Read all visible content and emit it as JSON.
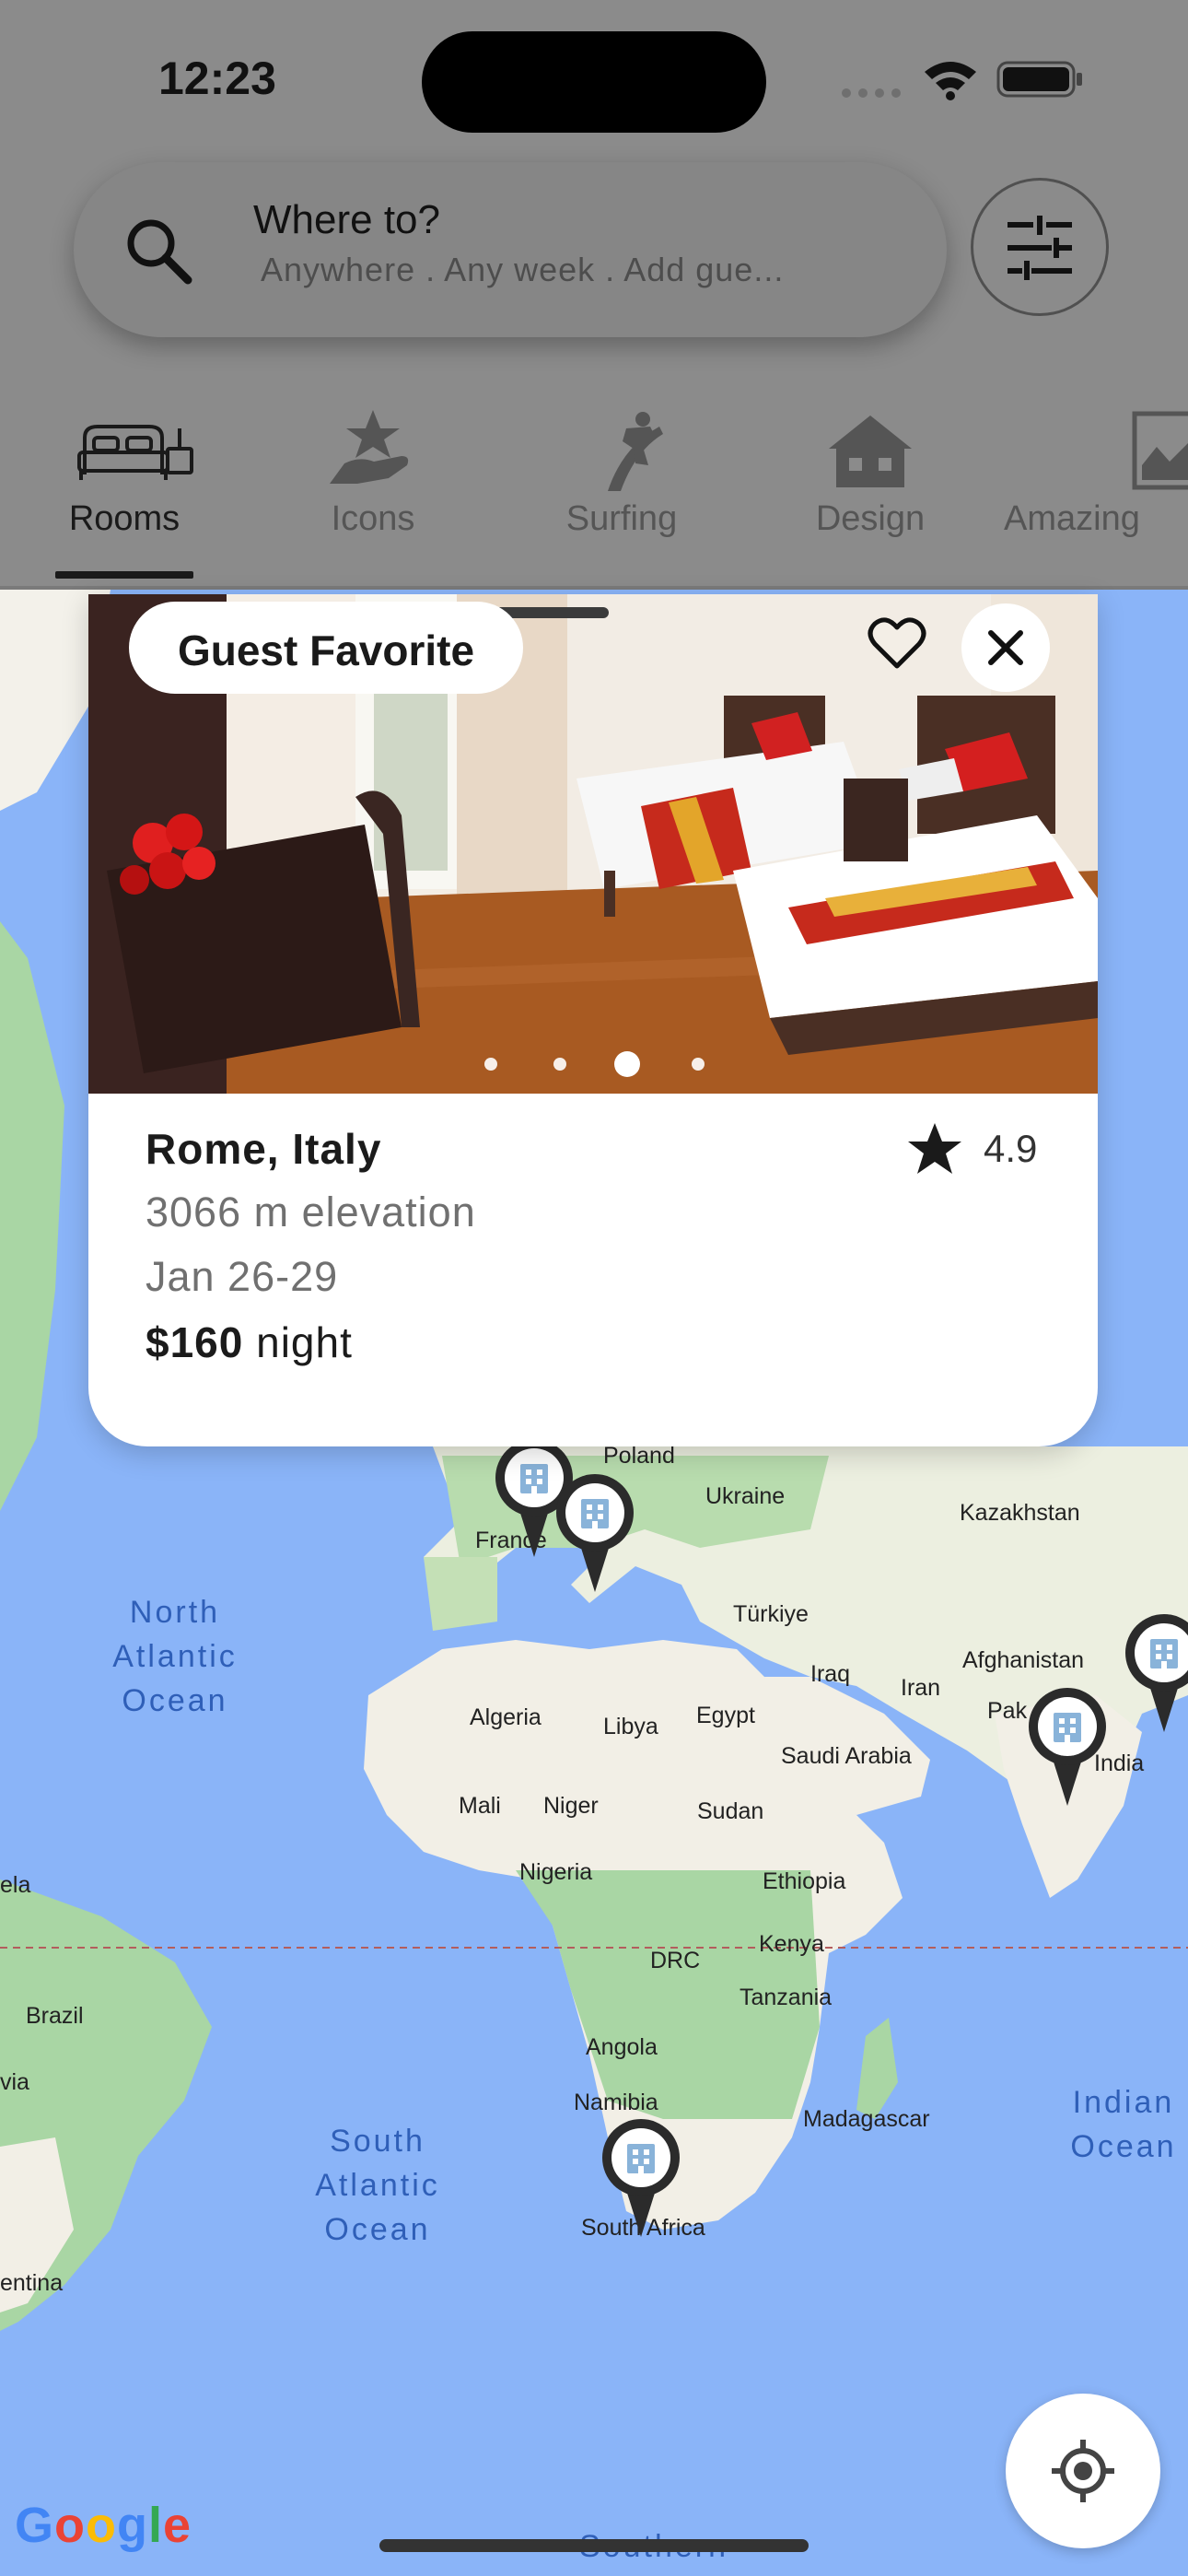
{
  "status_bar": {
    "time": "12:23"
  },
  "search": {
    "title": "Where to?",
    "subtitle": "Anywhere . Any week . Add gue..."
  },
  "categories": [
    {
      "label": "Rooms",
      "icon": "bed-icon",
      "selected": true
    },
    {
      "label": "Icons",
      "icon": "star-hand-icon",
      "selected": false
    },
    {
      "label": "Surfing",
      "icon": "surfer-icon",
      "selected": false
    },
    {
      "label": "Design",
      "icon": "house-icon",
      "selected": false
    },
    {
      "label": "Amazing",
      "icon": "framed-picture-icon",
      "selected": false
    }
  ],
  "listing": {
    "badge": "Guest Favorite",
    "title": "Rome, Italy",
    "rating": "4.9",
    "elevation": "3066 m elevation",
    "dates": "Jan 26-29",
    "price": "$160",
    "price_unit": "night",
    "photo_index": 3,
    "photo_count": 4
  },
  "map": {
    "countries": [
      "Poland",
      "Ukraine",
      "Kazakhstan",
      "France",
      "Türkiye",
      "Afghanistan",
      "Iraq",
      "Iran",
      "Pak",
      "Algeria",
      "Libya",
      "Egypt",
      "Saudi Arabia",
      "India",
      "Mali",
      "Niger",
      "Sudan",
      "Nigeria",
      "Ethiopia",
      "Kenya",
      "DRC",
      "Tanzania",
      "Angola",
      "Namibia",
      "Madagascar",
      "South Africa",
      "Brazil",
      "ela",
      "via",
      "entina"
    ],
    "oceans": [
      "North\nAtlantic\nOcean",
      "South\nAtlantic\nOcean",
      "Indian\nOcean",
      "Southern"
    ],
    "attribution": "Google"
  },
  "colors": {
    "ocean": "#8ab4f8",
    "land": "#f1efe6",
    "forest": "#a8d5a2",
    "scrim": "#8b8b8b",
    "pin": "#2b2b2b"
  }
}
